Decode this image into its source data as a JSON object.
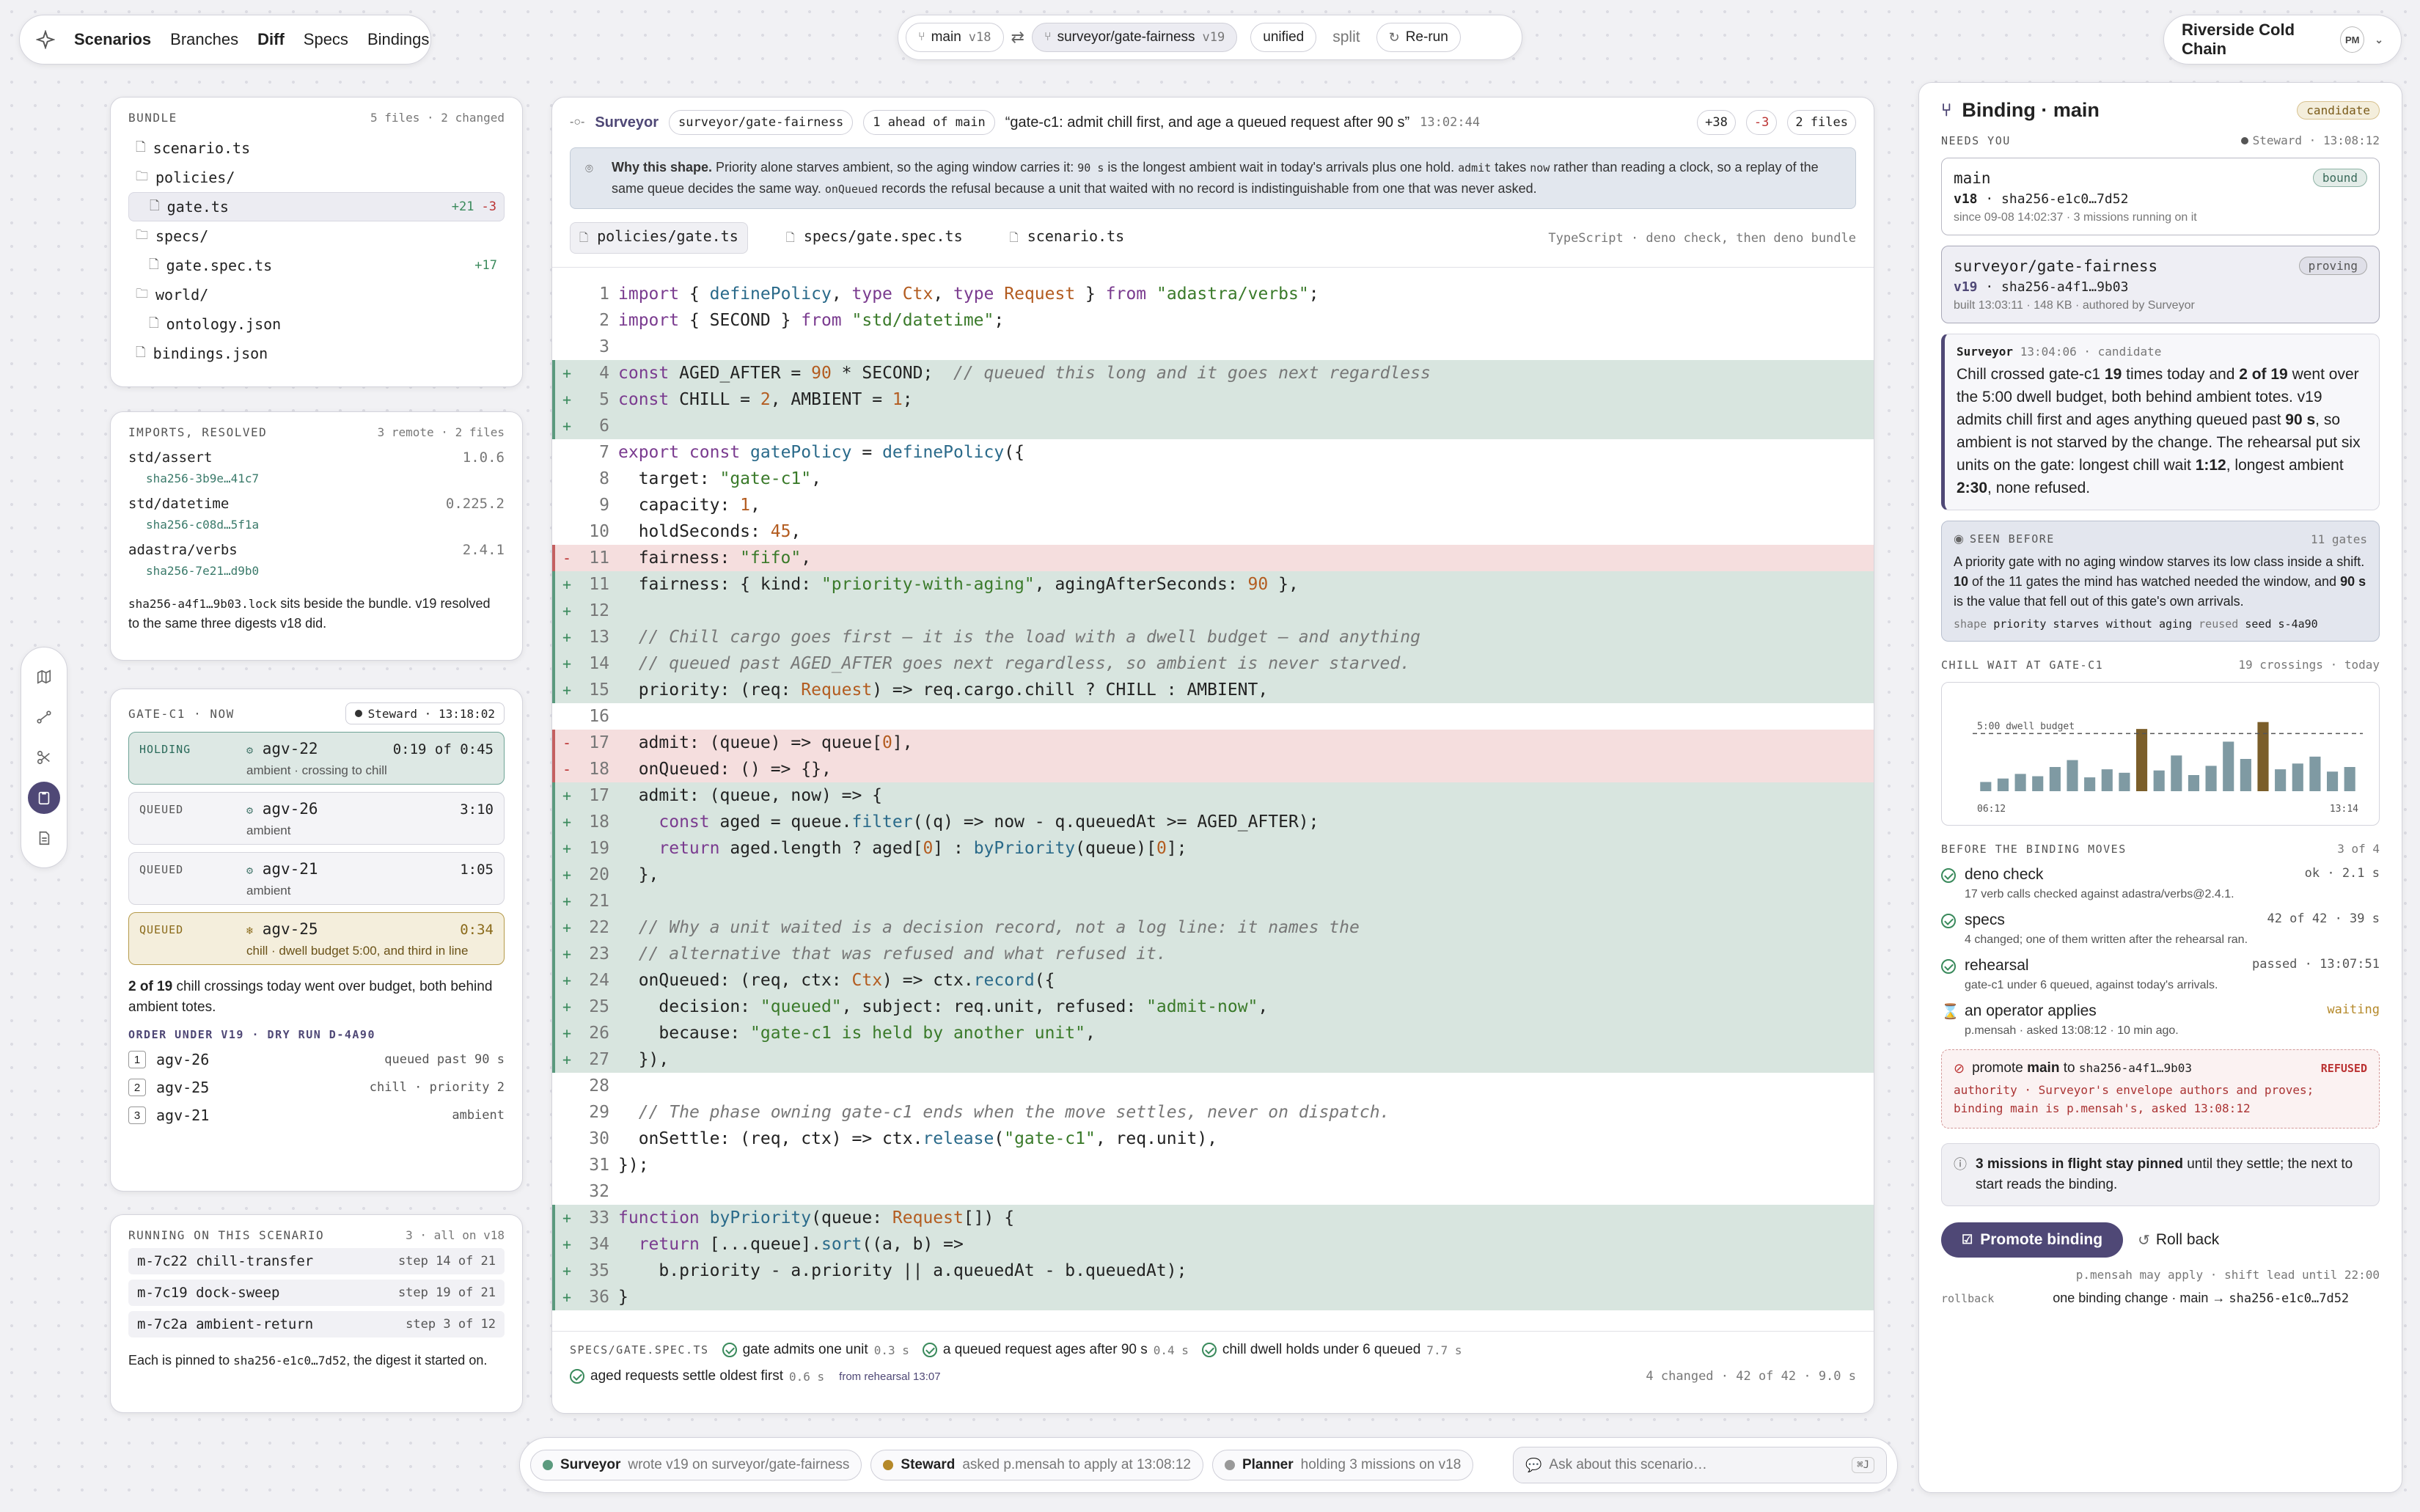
{
  "nav": {
    "app_title": "Scenarios",
    "items": [
      "Branches",
      "Diff",
      "Specs",
      "Bindings"
    ],
    "active": "Diff"
  },
  "diffbar": {
    "base_branch": "main",
    "base_version": "v18",
    "head_branch": "surveyor/gate-fairness",
    "head_version": "v19",
    "unified": "unified",
    "split": "split",
    "rerun": "Re-run"
  },
  "project": {
    "name": "Riverside Cold Chain",
    "avatar": "PM"
  },
  "bundle": {
    "title": "BUNDLE",
    "meta": "5 files · 2 changed",
    "files": [
      {
        "name": "scenario.ts",
        "type": "file",
        "depth": 0,
        "delta": ""
      },
      {
        "name": "policies/",
        "type": "folder",
        "depth": 0,
        "delta": ""
      },
      {
        "name": "gate.ts",
        "type": "file",
        "depth": 1,
        "delta_add": "+21",
        "delta_del": "-3"
      },
      {
        "name": "specs/",
        "type": "folder",
        "depth": 0,
        "delta": ""
      },
      {
        "name": "gate.spec.ts",
        "type": "file",
        "depth": 1,
        "delta_add": "+17"
      },
      {
        "name": "world/",
        "type": "folder",
        "depth": 0,
        "delta": ""
      },
      {
        "name": "ontology.json",
        "type": "file",
        "depth": 1,
        "delta": ""
      },
      {
        "name": "bindings.json",
        "type": "file",
        "depth": 0,
        "delta": ""
      }
    ]
  },
  "imports": {
    "title": "IMPORTS, RESOLVED",
    "meta": "3 remote · 2 files",
    "items": [
      {
        "name": "std/assert",
        "version": "1.0.6",
        "digest": "sha256-3b9e…41c7"
      },
      {
        "name": "std/datetime",
        "version": "0.225.2",
        "digest": "sha256-c08d…5f1a"
      },
      {
        "name": "adastra/verbs",
        "version": "2.4.1",
        "digest": "sha256-7e21…d9b0"
      }
    ],
    "note_mono": "sha256-a4f1…9b03.lock",
    "note_rest": " sits beside the bundle. v19 resolved to the same three digests v18 did."
  },
  "gate": {
    "title": "GATE-C1 · NOW",
    "steward": "Steward · 13:18:02",
    "queue": [
      {
        "state": "HOLDING",
        "agv": "agv-22",
        "sub": "ambient · crossing to chill",
        "time": "0:19 of 0:45",
        "kind": "hold"
      },
      {
        "state": "QUEUED",
        "agv": "agv-26",
        "sub": "ambient",
        "time": "3:10",
        "kind": ""
      },
      {
        "state": "QUEUED",
        "agv": "agv-21",
        "sub": "ambient",
        "time": "1:05",
        "kind": ""
      },
      {
        "state": "QUEUED",
        "agv": "agv-25",
        "sub": "chill · dwell budget 5:00, and third in line",
        "time": "0:34",
        "kind": "warn"
      }
    ],
    "summary_bold": "2 of 19",
    "summary_rest": " chill crossings today went over budget, both behind ambient totes.",
    "order_title": "ORDER UNDER V19 · DRY RUN D-4A90",
    "order": [
      {
        "n": "1",
        "agv": "agv-26",
        "why": "queued past 90 s"
      },
      {
        "n": "2",
        "agv": "agv-25",
        "why": "chill · priority 2"
      },
      {
        "n": "3",
        "agv": "agv-21",
        "why": "ambient"
      }
    ]
  },
  "running": {
    "title": "RUNNING ON THIS SCENARIO",
    "meta": "3 · all on v18",
    "items": [
      {
        "id": "m-7c22",
        "name": "chill-transfer",
        "step": "step 14 of 21"
      },
      {
        "id": "m-7c19",
        "name": "dock-sweep",
        "step": "step 19 of 21"
      },
      {
        "id": "m-7c2a",
        "name": "ambient-return",
        "step": "step 3 of 12"
      }
    ],
    "note_a": "Each is pinned to ",
    "note_mono": "sha256-e1c0…7d52",
    "note_b": ", the digest it started on."
  },
  "main": {
    "author": "Surveyor",
    "branch": "surveyor/gate-fairness",
    "ahead": "1 ahead of main",
    "message": "“gate-c1: admit chill first, and age a queued request after 90 s”",
    "time": "13:02:44",
    "adds": "+38",
    "dels": "-3",
    "files": "2 files",
    "why_title": "Why this shape.",
    "why_text_1": " Priority alone starves ambient, so the aging window carries it: ",
    "why_m1": "90 s",
    "why_text_2": " is the longest ambient wait in today's arrivals plus one hold. ",
    "why_m2": "admit",
    "why_text_3": " takes ",
    "why_m3": "now",
    "why_text_4": " rather than reading a clock, so a replay of the same queue decides the same way. ",
    "why_m4": "onQueued",
    "why_text_5": " records the refusal because a unit that waited with no record is indistinguishable from one that was never asked.",
    "tabs": [
      "policies/gate.ts",
      "specs/gate.spec.ts",
      "scenario.ts"
    ],
    "lang": "TypeScript · deno check, then deno bundle"
  },
  "spec": {
    "title": "SPECS/GATE.SPEC.TS",
    "items": [
      {
        "name": "gate admits one unit",
        "t": "0.3 s"
      },
      {
        "name": "a queued request ages after 90 s",
        "t": "0.4 s"
      },
      {
        "name": "chill dwell holds under 6 queued",
        "t": "7.7 s"
      },
      {
        "name": "aged requests settle oldest first",
        "t": "0.6 s",
        "extra": "from rehearsal 13:07"
      }
    ],
    "summary": "4 changed · 42 of 42 · 9.0 s"
  },
  "binding": {
    "title": "Binding · main",
    "badge": "candidate",
    "needs": "NEEDS YOU",
    "steward": "Steward · 13:08:12",
    "main_card": {
      "name": "main",
      "tag": "bound",
      "version": "v18",
      "digest": "sha256-e1c0…7d52",
      "meta": "since 09-08 14:02:37 · 3 missions running on it"
    },
    "cand_card": {
      "name": "surveyor/gate-fairness",
      "tag": "proving",
      "version": "v19",
      "digest": "sha256-a4f1…9b03",
      "meta": "built 13:03:11 · 148 KB · authored by Surveyor"
    },
    "sv_head": "Surveyor",
    "sv_time": "13:04:06 · candidate",
    "sv_p1": "Chill crossed gate-c1 ",
    "sv_b1": "19",
    "sv_p2": " times today and ",
    "sv_b2": "2 of 19",
    "sv_p3": " went over the 5:00 dwell budget, both behind ambient totes. v19 admits chill first and ages anything queued past ",
    "sv_b3": "90 s",
    "sv_p4": ", so ambient is not starved by the change. The rehearsal put six units on the gate: longest chill wait ",
    "sv_b4": "1:12",
    "sv_p5": ", longest ambient ",
    "sv_b5": "2:30",
    "sv_p6": ", none refused.",
    "seen_title": "SEEN BEFORE",
    "seen_meta": "11 gates",
    "seen_p1": "A priority gate with no aging window starves its low class inside a shift. ",
    "seen_b1": "10",
    "seen_p2": " of the 11 gates the mind has watched needed the window, and ",
    "seen_b2": "90 s",
    "seen_p3": " is the value that fell out of this gate's own arrivals.",
    "shape_lbl": "shape",
    "shape_val": "priority starves without aging",
    "reused_lbl": "reused",
    "reused_val": "seed s-4a90",
    "chart_title": "CHILL WAIT AT GATE-C1",
    "chart_meta": "19 crossings · today",
    "checks_title": "BEFORE THE BINDING MOVES",
    "checks_meta": "3 of 4",
    "checks": [
      {
        "name": "deno check",
        "status": "ok · 2.1 s",
        "sub": "17 verb calls checked against adastra/verbs@2.4.1."
      },
      {
        "name": "specs",
        "status": "42 of 42 · 39 s",
        "sub": "4 changed; one of them written after the rehearsal ran."
      },
      {
        "name": "rehearsal",
        "status": "passed · 13:07:51",
        "sub": "gate-c1 under 6 queued, against today's arrivals."
      },
      {
        "name": "an operator applies",
        "status": "waiting",
        "sub": "p.mensah · asked 13:08:12 · 10 min ago."
      }
    ],
    "refused_a": "promote ",
    "refused_b": "main",
    "refused_c": " to ",
    "refused_d": "sha256-a4f1…9b03",
    "refused_tag": "REFUSED",
    "refused_l1": "authority · Surveyor's envelope authors and proves;",
    "refused_l2": "binding main is p.mensah's, asked 13:08:12",
    "pin_b": "3 missions in flight stay pinned",
    "pin_r": " until they settle; the next to start reads the binding.",
    "promote": "Promote binding",
    "rollback": "Roll back",
    "may_apply": "p.mensah may apply · shift lead until 22:00",
    "rb_lbl": "rollback",
    "rb_a": "one binding change · main → ",
    "rb_b": "sha256-e1c0…7d52"
  },
  "chart_data": {
    "type": "bar",
    "title": "CHILL WAIT AT GATE-C1",
    "subtitle": "19 crossings · today",
    "x_start": "06:12",
    "x_end": "13:14",
    "budget_label": "5:00 dwell budget",
    "budget": 5.0,
    "values": [
      0.8,
      1.1,
      1.5,
      1.3,
      2.1,
      2.7,
      1.2,
      1.9,
      1.6,
      5.4,
      1.8,
      3.1,
      1.4,
      2.2,
      4.3,
      2.8,
      6.0,
      1.9,
      2.4,
      3.0,
      1.7,
      2.1
    ],
    "over_budget": [
      9,
      16
    ],
    "ylim": [
      0,
      7
    ]
  },
  "bottom": {
    "agents": [
      {
        "name": "Surveyor",
        "text": "wrote v19 on surveyor/gate-fairness",
        "color": "#5b9a7e"
      },
      {
        "name": "Steward",
        "text": "asked p.mensah to apply at 13:08:12",
        "color": "#b5892a"
      },
      {
        "name": "Planner",
        "text": "holding 3 missions on v18",
        "color": "#999999"
      }
    ],
    "ask_placeholder": "Ask about this scenario…",
    "kbd": "⌘J"
  }
}
